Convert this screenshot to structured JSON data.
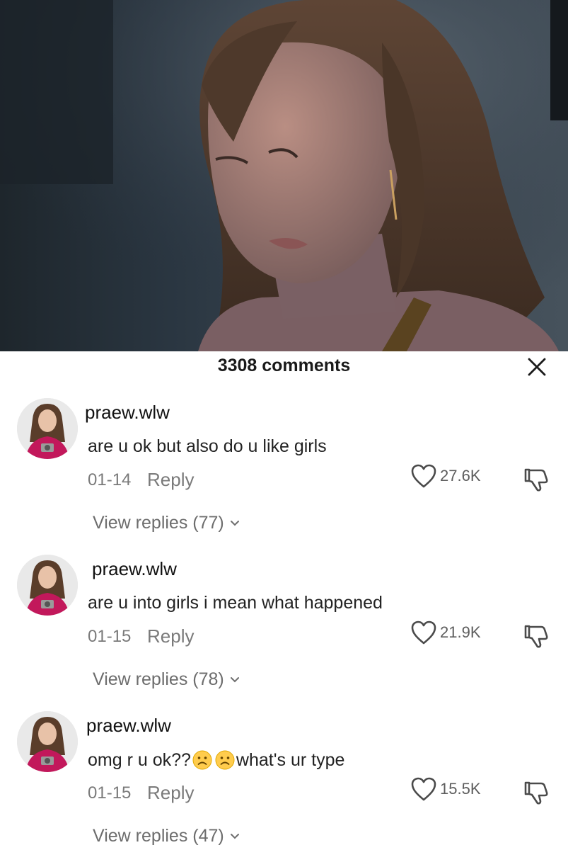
{
  "panel": {
    "title": "3308 comments"
  },
  "comments": [
    {
      "username": "praew.wlw",
      "text": "are u ok but also do u like girls",
      "date": "01-14",
      "reply_label": "Reply",
      "likes": "27.6K",
      "view_replies": "View replies (77)"
    },
    {
      "username": "praew.wlw",
      "text": "are u into girls i mean what happened",
      "date": "01-15",
      "reply_label": "Reply",
      "likes": "21.9K",
      "view_replies": "View replies (78)"
    },
    {
      "username": "praew.wlw",
      "text_before": "omg r u ok??",
      "emojis": [
        "frowning-face-emoji",
        "frowning-face-emoji"
      ],
      "text_after": "what's ur type",
      "date": "01-15",
      "reply_label": "Reply",
      "likes": "15.5K",
      "view_replies": "View replies (47)"
    }
  ],
  "icons": {
    "close": "close-icon",
    "like": "heart-icon",
    "dislike": "thumbs-down-icon",
    "chevron": "chevron-down-icon"
  },
  "colors": {
    "panel_bg": "#ffffff",
    "primary_text": "#1a1a1a",
    "secondary_text": "#7a7a7a",
    "avatar_shirt": "#c2185b"
  }
}
